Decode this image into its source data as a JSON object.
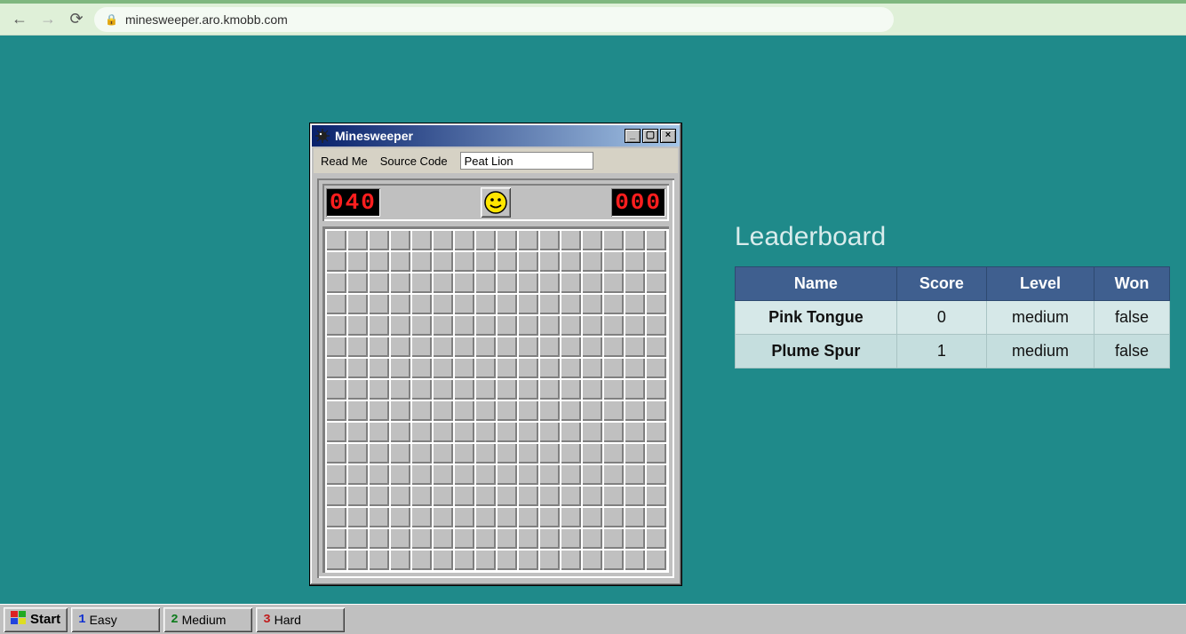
{
  "browser": {
    "url": "minesweeper.aro.kmobb.com"
  },
  "window": {
    "title": "Minesweeper",
    "menu": {
      "readme": "Read Me",
      "source": "Source Code"
    },
    "player_name": "Peat Lion",
    "mine_counter": "040",
    "time_counter": "000",
    "grid": {
      "rows": 16,
      "cols": 16
    }
  },
  "leaderboard": {
    "title": "Leaderboard",
    "columns": [
      "Name",
      "Score",
      "Level",
      "Won"
    ],
    "rows": [
      {
        "name": "Pink Tongue",
        "score": "0",
        "level": "medium",
        "won": "false"
      },
      {
        "name": "Plume Spur",
        "score": "1",
        "level": "medium",
        "won": "false"
      }
    ]
  },
  "taskbar": {
    "start": "Start",
    "items": [
      {
        "num": "1",
        "label": "Easy"
      },
      {
        "num": "2",
        "label": "Medium"
      },
      {
        "num": "3",
        "label": "Hard"
      }
    ]
  }
}
